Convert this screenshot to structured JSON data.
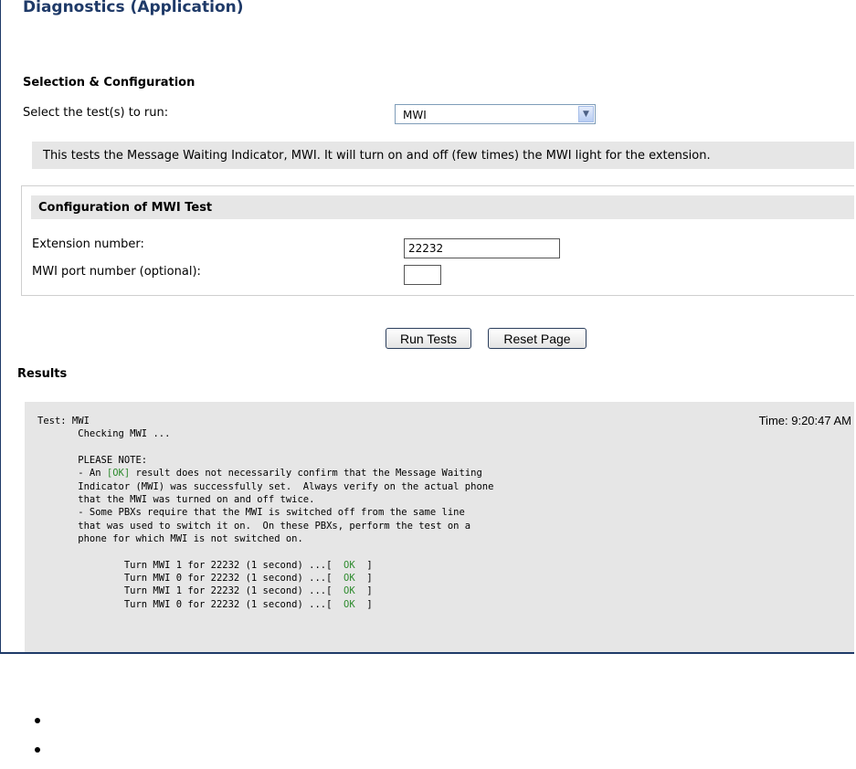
{
  "page": {
    "title": "Diagnostics (Application)"
  },
  "selection": {
    "section_title": "Selection & Configuration",
    "select_label": "Select the test(s) to run:",
    "selected_test": "MWI",
    "description": "This tests the Message Waiting Indicator, MWI. It will turn on and off (few times) the MWI light for the extension."
  },
  "config": {
    "header": "Configuration of MWI Test",
    "extension_label": "Extension number:",
    "extension_value": "22232",
    "port_label": "MWI port number (optional):",
    "port_value": ""
  },
  "buttons": {
    "run": "Run Tests",
    "reset": "Reset Page"
  },
  "results": {
    "title": "Results",
    "time": "Time: 9:20:47 AM",
    "lines": [
      {
        "indent": "",
        "text": "Test: MWI"
      },
      {
        "indent": "       ",
        "text": "Checking MWI ..."
      },
      {
        "indent": "",
        "text": ""
      },
      {
        "indent": "       ",
        "text": "PLEASE NOTE:"
      },
      {
        "indent": "       ",
        "text": "- An ",
        "ok": "[OK]",
        "after": " result does not necessarily confirm that the Message Waiting"
      },
      {
        "indent": "       ",
        "text": "Indicator (MWI) was successfully set.  Always verify on the actual phone"
      },
      {
        "indent": "       ",
        "text": "that the MWI was turned on and off twice."
      },
      {
        "indent": "       ",
        "text": "- Some PBXs require that the MWI is switched off from the same line"
      },
      {
        "indent": "       ",
        "text": "that was used to switch it on.  On these PBXs, perform the test on a"
      },
      {
        "indent": "       ",
        "text": "phone for which MWI is not switched on."
      },
      {
        "indent": "",
        "text": ""
      },
      {
        "indent": "               ",
        "text": "Turn MWI 1 for 22232 (1 second) ...[",
        "ok": "  OK  ",
        "after": "]"
      },
      {
        "indent": "               ",
        "text": "Turn MWI 0 for 22232 (1 second) ...[",
        "ok": "  OK  ",
        "after": "]"
      },
      {
        "indent": "               ",
        "text": "Turn MWI 1 for 22232 (1 second) ...[",
        "ok": "  OK  ",
        "after": "]"
      },
      {
        "indent": "               ",
        "text": "Turn MWI 0 for 22232 (1 second) ...[",
        "ok": "  OK  ",
        "after": "]"
      }
    ]
  },
  "bullets": [
    "",
    ""
  ]
}
